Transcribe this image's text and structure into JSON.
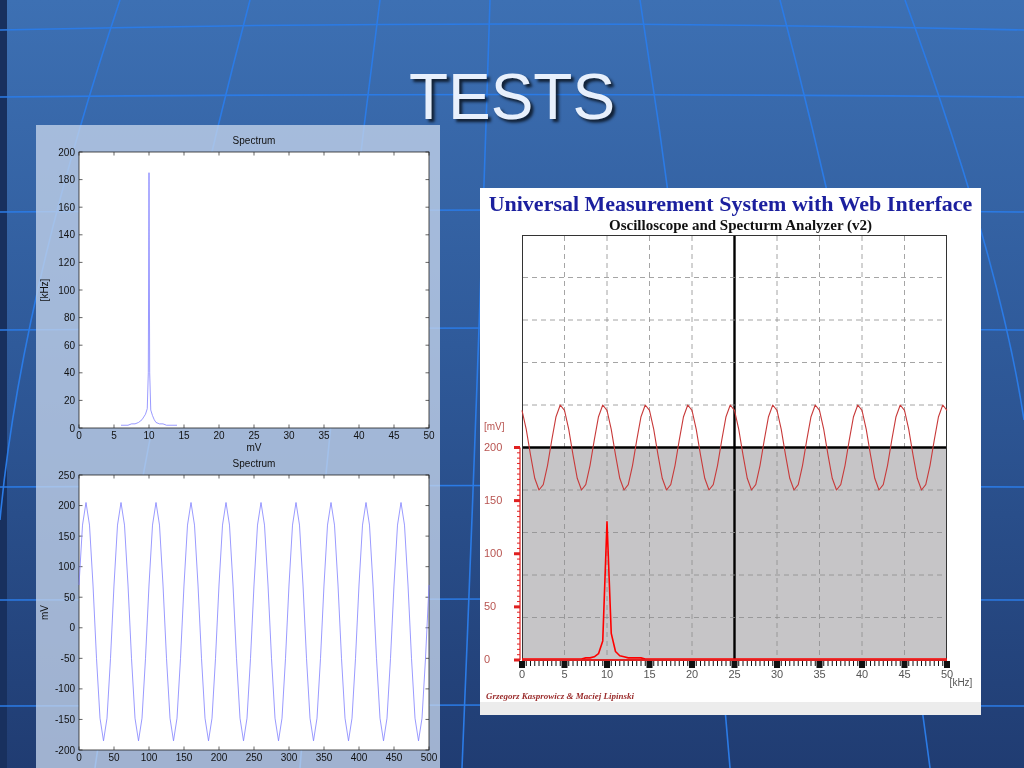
{
  "slide": {
    "title": "TESTS"
  },
  "left_panel": {
    "charts": [
      {
        "chart_data": {
          "type": "line",
          "title": "Spectrum",
          "xlabel": "mV",
          "ylabel": "[kHz]",
          "x": [
            6,
            7,
            7.5,
            8,
            8.5,
            9,
            9.25,
            9.5,
            9.75,
            9.9,
            10,
            10.1,
            10.25,
            10.5,
            10.75,
            11,
            11.5,
            12,
            12.5,
            13,
            14
          ],
          "series": [
            {
              "color": "#8080ff",
              "values": [
                2,
                2,
                3,
                3,
                4,
                6,
                8,
                10,
                14,
                40,
                185,
                40,
                13,
                9,
                6,
                4,
                3,
                3,
                2,
                2,
                2
              ]
            }
          ],
          "xlim": [
            0,
            50
          ],
          "ylim": [
            0,
            200
          ],
          "xticks": [
            0,
            5,
            10,
            15,
            20,
            25,
            30,
            35,
            40,
            45,
            50
          ],
          "yticks": [
            0,
            20,
            40,
            60,
            80,
            100,
            120,
            140,
            160,
            180,
            200
          ]
        }
      },
      {
        "chart_data": {
          "type": "line",
          "title": "Spectrum",
          "ylabel": "mV",
          "x": [
            0,
            5,
            10,
            15,
            20,
            25,
            30,
            35,
            40,
            45,
            50,
            55,
            60,
            65,
            70,
            75,
            80,
            85,
            90,
            95,
            100,
            105,
            110,
            115,
            120,
            125,
            130,
            135,
            140,
            145,
            150,
            155,
            160,
            165,
            170,
            175,
            180,
            185,
            190,
            195,
            200,
            205,
            210,
            215,
            220,
            225,
            230,
            235,
            240,
            245,
            250,
            255,
            260,
            265,
            270,
            275,
            280,
            285,
            290,
            295,
            300,
            305,
            310,
            315,
            320,
            325,
            330,
            335,
            340,
            345,
            350,
            355,
            360,
            365,
            370,
            375,
            380,
            385,
            390,
            395,
            400,
            405,
            410,
            415,
            420,
            425,
            430,
            435,
            440,
            445,
            450,
            455,
            460,
            465,
            470,
            475,
            480,
            485,
            490,
            495,
            500
          ],
          "series": [
            {
              "color": "#8080ff",
              "values": [
                70,
                168,
                205,
                168,
                70,
                -50,
                -148,
                -185,
                -148,
                -50,
                70,
                168,
                205,
                168,
                70,
                -50,
                -148,
                -185,
                -148,
                -50,
                70,
                168,
                205,
                168,
                70,
                -50,
                -148,
                -185,
                -148,
                -50,
                70,
                168,
                205,
                168,
                70,
                -50,
                -148,
                -185,
                -148,
                -50,
                70,
                168,
                205,
                168,
                70,
                -50,
                -148,
                -185,
                -148,
                -50,
                70,
                168,
                205,
                168,
                70,
                -50,
                -148,
                -185,
                -148,
                -50,
                70,
                168,
                205,
                168,
                70,
                -50,
                -148,
                -185,
                -148,
                -50,
                70,
                168,
                205,
                168,
                70,
                -50,
                -148,
                -185,
                -148,
                -50,
                70,
                168,
                205,
                168,
                70,
                -50,
                -148,
                -185,
                -148,
                -50,
                70,
                168,
                205,
                168,
                70,
                -50,
                -148,
                -185,
                -148,
                -50,
                70
              ]
            }
          ],
          "xlim": [
            0,
            500
          ],
          "ylim": [
            -200,
            250
          ],
          "xticks": [
            0,
            50,
            100,
            150,
            200,
            250,
            300,
            350,
            400,
            450,
            500
          ],
          "yticks": [
            -200,
            -150,
            -100,
            -50,
            0,
            50,
            100,
            150,
            200,
            250
          ]
        }
      }
    ]
  },
  "right_panel": {
    "title": "Universal Measurement System with Web Interface",
    "chart_data": {
      "type": "line",
      "title": "Oscilloscope and Specturm Analyzer (v2)",
      "xlabel": "[kHz]",
      "ylabel": "[mV]",
      "x": [
        0,
        0.5,
        1,
        1.5,
        2,
        2.5,
        3,
        3.5,
        4,
        4.5,
        5,
        5.5,
        6,
        6.5,
        7,
        7.5,
        8,
        8.5,
        9,
        9.5,
        10,
        10.5,
        11,
        11.5,
        12,
        12.5,
        13,
        13.5,
        14,
        14.5,
        15,
        15.5,
        16,
        16.5,
        17,
        17.5,
        18,
        18.5,
        19,
        19.5,
        20,
        20.5,
        21,
        21.5,
        22,
        22.5,
        23,
        23.5,
        24,
        24.5,
        25,
        25.5,
        26,
        26.5,
        27,
        27.5,
        28,
        28.5,
        29,
        29.5,
        30,
        30.5,
        31,
        31.5,
        32,
        32.5,
        33,
        33.5,
        34,
        34.5,
        35,
        35.5,
        36,
        36.5,
        37,
        37.5,
        38,
        38.5,
        39,
        39.5,
        40,
        40.5,
        41,
        41.5,
        42,
        42.5,
        43,
        43.5,
        44,
        44.5,
        45,
        45.5,
        46,
        46.5,
        47,
        47.5,
        48,
        48.5,
        49,
        49.5,
        50
      ],
      "series": [
        {
          "color": "#c83a3a",
          "values": [
            235,
            217,
            193,
            171,
            160,
            165,
            183,
            207,
            229,
            240,
            235,
            217,
            193,
            171,
            160,
            165,
            183,
            207,
            229,
            240,
            235,
            217,
            193,
            171,
            160,
            165,
            183,
            207,
            229,
            240,
            235,
            217,
            193,
            171,
            160,
            165,
            183,
            207,
            229,
            240,
            235,
            217,
            193,
            171,
            160,
            165,
            183,
            207,
            229,
            240,
            235,
            217,
            193,
            171,
            160,
            165,
            183,
            207,
            229,
            240,
            235,
            217,
            193,
            171,
            160,
            165,
            183,
            207,
            229,
            240,
            235,
            217,
            193,
            171,
            160,
            165,
            183,
            207,
            229,
            240,
            235,
            217,
            193,
            171,
            160,
            165,
            183,
            207,
            229,
            240,
            235,
            217,
            193,
            171,
            160,
            165,
            183,
            207,
            229,
            240,
            235
          ]
        },
        {
          "color": "#ff0000",
          "values": [
            1,
            1,
            1,
            1,
            1,
            1,
            1,
            1,
            1,
            1,
            1,
            1,
            1,
            1,
            1,
            2,
            2,
            3,
            6,
            18,
            130,
            25,
            8,
            4,
            3,
            2,
            2,
            2,
            2,
            1,
            1,
            1,
            1,
            1,
            1,
            1,
            1,
            1,
            1,
            1,
            1,
            1,
            1,
            1,
            1,
            1,
            1,
            1,
            1,
            1,
            1,
            1,
            1,
            1,
            1,
            1,
            1,
            1,
            1,
            1,
            1,
            1,
            1,
            1,
            1,
            1,
            1,
            1,
            1,
            1,
            1,
            1,
            1,
            1,
            1,
            1,
            1,
            1,
            1,
            1,
            1,
            1,
            1,
            1,
            1,
            1,
            1,
            1,
            1,
            1,
            1,
            1,
            1,
            1,
            1,
            1,
            1,
            1,
            1,
            1,
            1
          ]
        }
      ],
      "xlim": [
        0,
        50
      ],
      "ylim": [
        0,
        400
      ],
      "xticks": [
        0,
        5,
        10,
        15,
        20,
        25,
        30,
        35,
        40,
        45,
        50
      ],
      "yticks": [
        0,
        50,
        100,
        150,
        200
      ],
      "grid": true,
      "bands": [
        {
          "axis": "y",
          "from": 0,
          "to": 200,
          "color": "#c6c5c7"
        }
      ],
      "ref_lines": [
        {
          "axis": "y",
          "value": 200
        }
      ]
    },
    "credit": "Grzegorz Kasprowicz & Maciej Lipinski"
  }
}
